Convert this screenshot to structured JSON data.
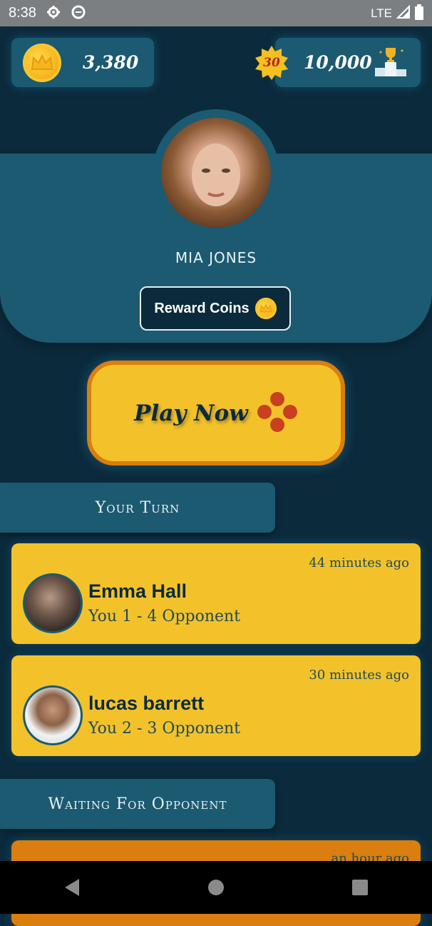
{
  "status_bar": {
    "time": "8:38",
    "network": "LTE"
  },
  "header": {
    "coins": "3,380",
    "level": "30",
    "score": "10,000"
  },
  "profile": {
    "name": "MIA JONES",
    "reward_button_label": "Reward Coins"
  },
  "play_button": {
    "label": "Play Now"
  },
  "sections": {
    "your_turn": "Your Turn",
    "waiting": "Waiting For Opponent"
  },
  "your_turn_games": [
    {
      "name": "Emma Hall",
      "score": "You 1 - 4 Opponent",
      "time": "44 minutes ago"
    },
    {
      "name": "lucas barrett",
      "score": "You 2 - 3 Opponent",
      "time": "30 minutes ago"
    }
  ],
  "waiting_games": [
    {
      "time": "an hour ago"
    }
  ],
  "colors": {
    "background": "#0b2a3c",
    "panel": "#1b5a71",
    "card_yellow": "#f3c22b",
    "card_orange": "#d97e0f",
    "dice_red": "#c8401f"
  }
}
